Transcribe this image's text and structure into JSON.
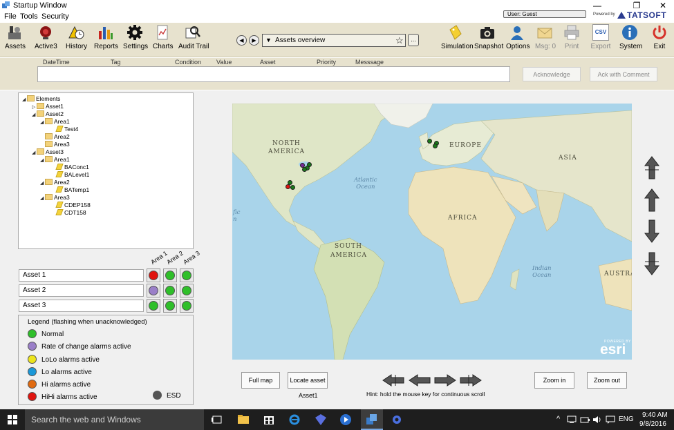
{
  "window": {
    "title": "Startup Window",
    "controls": {
      "minimize": "—",
      "maximize": "❐",
      "close": "✕"
    },
    "powered_by_label": "Powered by",
    "brand": "TATSOFT",
    "user_label": "User: Guest"
  },
  "menu": [
    "File",
    "Tools",
    "Security"
  ],
  "toolbar": {
    "left_buttons": [
      {
        "label": "Assets",
        "icon": "assets-icon"
      },
      {
        "label": "Active3",
        "icon": "active-alarm-icon"
      },
      {
        "label": "History",
        "icon": "history-icon"
      },
      {
        "label": "Reports",
        "icon": "reports-icon"
      },
      {
        "label": "Settings",
        "icon": "gear-icon"
      },
      {
        "label": "Charts",
        "icon": "charts-icon"
      },
      {
        "label": "Audit Trail",
        "icon": "audit-trail-icon"
      }
    ],
    "nav_back": "◀",
    "nav_forward": "▶",
    "page_selector": "Assets overview",
    "favorite_glyph": "☆",
    "more_button": "...",
    "right_buttons": [
      {
        "label": "Simulation",
        "icon": "simulation-icon"
      },
      {
        "label": "Snapshot",
        "icon": "camera-icon"
      },
      {
        "label": "Options",
        "icon": "user-icon"
      },
      {
        "label": "Msg: 0",
        "icon": "mail-icon"
      },
      {
        "label": "Print",
        "icon": "printer-icon"
      },
      {
        "label": "Export",
        "icon": "csv-icon",
        "badge": "CSV"
      },
      {
        "label": "System",
        "icon": "info-icon"
      },
      {
        "label": "Exit",
        "icon": "power-icon"
      }
    ]
  },
  "alarm": {
    "columns": [
      "DateTime",
      "Tag",
      "Condition",
      "Value",
      "Asset",
      "Priority",
      "Messsage"
    ],
    "acknowledge_label": "Acknowledge",
    "ack_comment_label": "Ack with Comment"
  },
  "tree": [
    {
      "label": "Elements",
      "type": "folder",
      "expander": "◢"
    },
    {
      "label": "Asset1",
      "type": "folder",
      "expander": "▷"
    },
    {
      "label": "Asset2",
      "type": "folder",
      "expander": "◢"
    },
    {
      "label": "Area1",
      "type": "folder",
      "expander": "◢"
    },
    {
      "label": "Test4",
      "type": "tag",
      "expander": ""
    },
    {
      "label": "Area2",
      "type": "folder",
      "expander": ""
    },
    {
      "label": "Area3",
      "type": "folder",
      "expander": ""
    },
    {
      "label": "Asset3",
      "type": "folder",
      "expander": "◢"
    },
    {
      "label": "Area1",
      "type": "folder",
      "expander": "◢"
    },
    {
      "label": "BAConc1",
      "type": "tag",
      "expander": ""
    },
    {
      "label": "BALevel1",
      "type": "tag",
      "expander": ""
    },
    {
      "label": "Area2",
      "type": "folder",
      "expander": "◢"
    },
    {
      "label": "BATemp1",
      "type": "tag",
      "expander": ""
    },
    {
      "label": "Area3",
      "type": "folder",
      "expander": "◢"
    },
    {
      "label": "CDEP158",
      "type": "tag",
      "expander": ""
    },
    {
      "label": "CDT158",
      "type": "tag",
      "expander": ""
    }
  ],
  "status_grid": {
    "area_headers": [
      "Area 1",
      "Area 2",
      "Area 3"
    ],
    "assets": [
      {
        "name": "Asset 1",
        "states": [
          "#e0140f",
          "#2fbf2a",
          "#2fbf2a"
        ]
      },
      {
        "name": "Asset 2",
        "states": [
          "#9a7fc8",
          "#2fbf2a",
          "#2fbf2a"
        ]
      },
      {
        "name": "Asset 3",
        "states": [
          "#2fbf2a",
          "#2fbf2a",
          "#2fbf2a"
        ]
      }
    ]
  },
  "legend": {
    "title": "Legend (flashing when unacknowledged)",
    "items": [
      {
        "label": "Normal",
        "color": "#2fbf2a"
      },
      {
        "label": "Rate of change alarms active",
        "color": "#9a7fc8"
      },
      {
        "label": "LoLo alarms active",
        "color": "#ece41c"
      },
      {
        "label": "Lo alarms active",
        "color": "#1a98d8"
      },
      {
        "label": "Hi alarms active",
        "color": "#e06a10"
      },
      {
        "label": "HiHi alarms active",
        "color": "#e0140f"
      }
    ],
    "esd_label": "ESD",
    "esd_color": "#555555"
  },
  "map": {
    "continent_labels": [
      "NORTH",
      "AMERICA",
      "EUROPE",
      "ASIA",
      "AFRICA",
      "SOUTH",
      "AMERICA",
      "AUSTRA"
    ],
    "ocean_labels": [
      "Atlantic\nOcean",
      "Indian\nOcean",
      "fic\nn"
    ],
    "attribution_small": "POWERED BY",
    "attribution": "esri",
    "markers": [
      "#1a7a1a",
      "#1a7a1a",
      "#1a7a1a",
      "#7a2a9a",
      "#1a7a1a",
      "#1a7a1a",
      "#1a7a1a",
      "#e0140f",
      "#1a7a1a",
      "#1a7a1a"
    ]
  },
  "bottom": {
    "full_map_label": "Full map",
    "locate_asset_label": "Locate asset",
    "selected_asset": "Asset1",
    "hint": "Hint: hold the mouse key for continuous scroll",
    "zoom_in_label": "Zoom in",
    "zoom_out_label": "Zoom out"
  },
  "taskbar": {
    "search_placeholder": "Search the web and Windows",
    "language": "ENG",
    "time": "9:40 AM",
    "date": "9/8/2016"
  }
}
